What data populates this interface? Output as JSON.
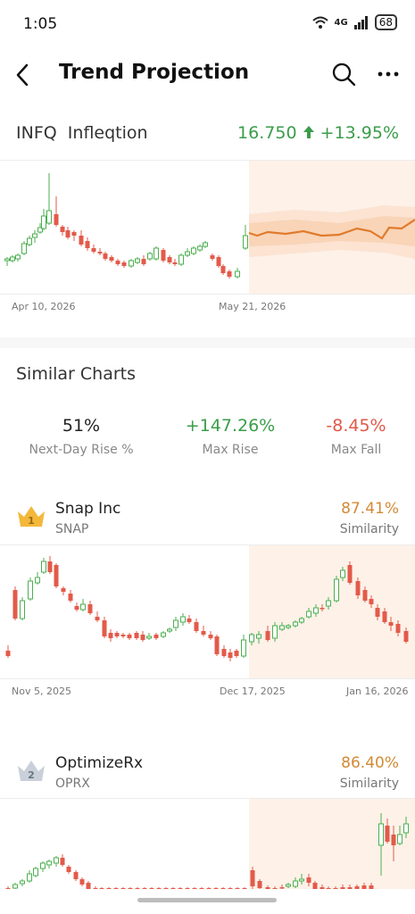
{
  "status_bar": {
    "time": "1:05",
    "network": "4G",
    "battery": "68"
  },
  "header": {
    "title": "Trend Projection"
  },
  "stock": {
    "ticker": "INFQ",
    "name": "Infleqtion",
    "price": "16.750",
    "change": "+13.95%"
  },
  "main_chart": {
    "date_start": "Apr 10, 2026",
    "date_end": "May 21, 2026"
  },
  "similar": {
    "title": "Similar Charts",
    "stats": [
      {
        "value": "51%",
        "label": "Next-Day Rise %"
      },
      {
        "value": "+147.26%",
        "label": "Max Rise"
      },
      {
        "value": "-8.45%",
        "label": "Max Fall"
      }
    ],
    "matches": [
      {
        "rank": "1",
        "name": "Snap Inc",
        "ticker": "SNAP",
        "similarity": "87.41%",
        "similarity_label": "Similarity",
        "dates": [
          "Nov 5, 2025",
          "Dec 17, 2025",
          "Jan 16, 2026"
        ]
      },
      {
        "rank": "2",
        "name": "OptimizeRx",
        "ticker": "OPRX",
        "similarity": "86.40%",
        "similarity_label": "Similarity"
      }
    ]
  },
  "colors": {
    "up": "#4caf50",
    "down": "#e35a4a",
    "accent": "#e07b2c",
    "projection_bg": "#fdf1e8"
  }
}
